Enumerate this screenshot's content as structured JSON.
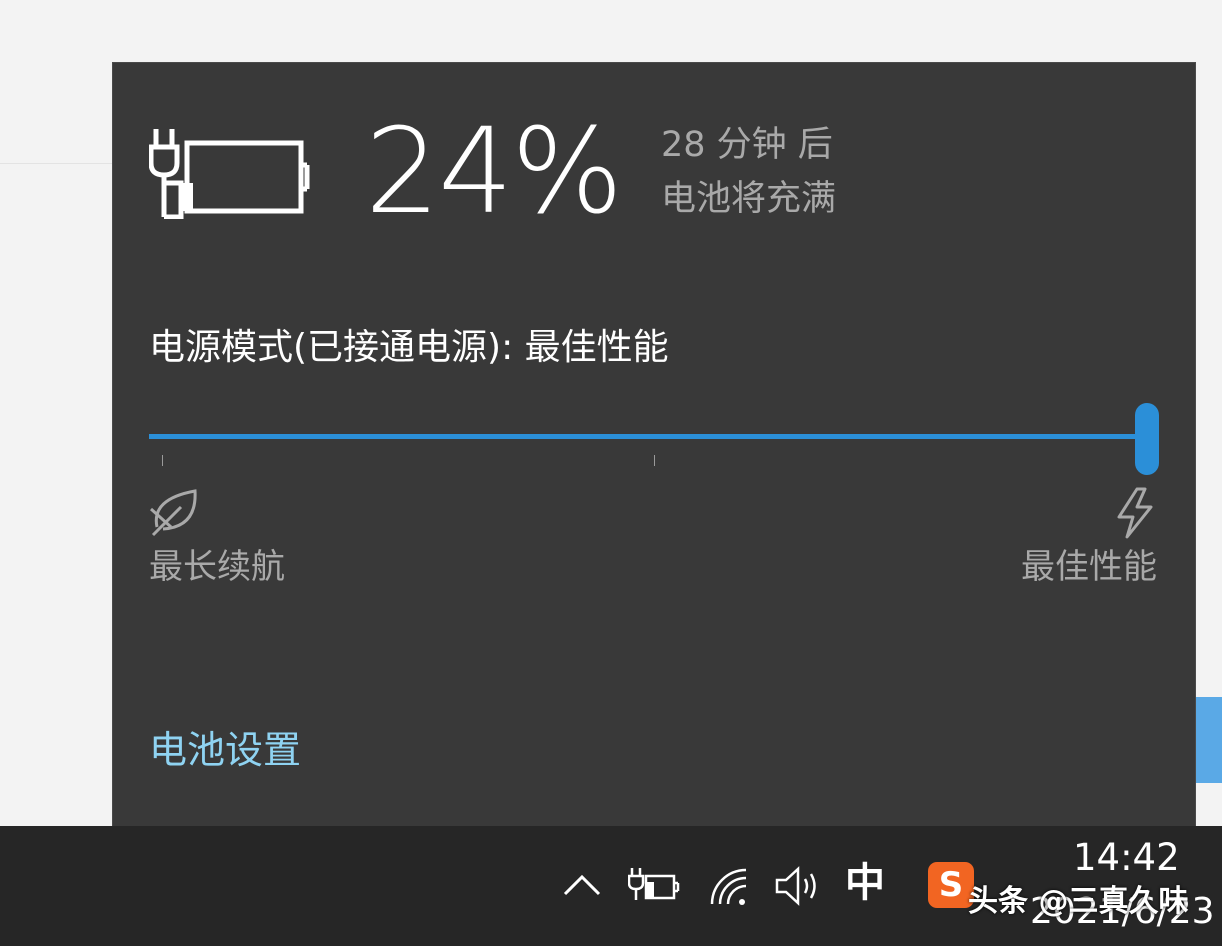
{
  "battery": {
    "percent": "24%",
    "charge_time": "28 分钟 后",
    "charge_desc": "电池将充满"
  },
  "power_mode": {
    "label": "电源模式(已接通电源): 最佳性能",
    "slider_level": 1.0,
    "left_label": "最长续航",
    "right_label": "最佳性能",
    "accent_color": "#2b8fd8"
  },
  "settings_link": "电池设置",
  "taskbar": {
    "ime_label": "中",
    "sogou_label": "S",
    "time": "14:42",
    "date": "2021/6/23",
    "watermark": "头条 @三真久味"
  },
  "icons": [
    "plug-battery-icon",
    "leaf-icon",
    "lightning-icon",
    "chevron-up-icon",
    "battery-charging-icon",
    "wifi-icon",
    "speaker-icon",
    "sogou-icon"
  ]
}
